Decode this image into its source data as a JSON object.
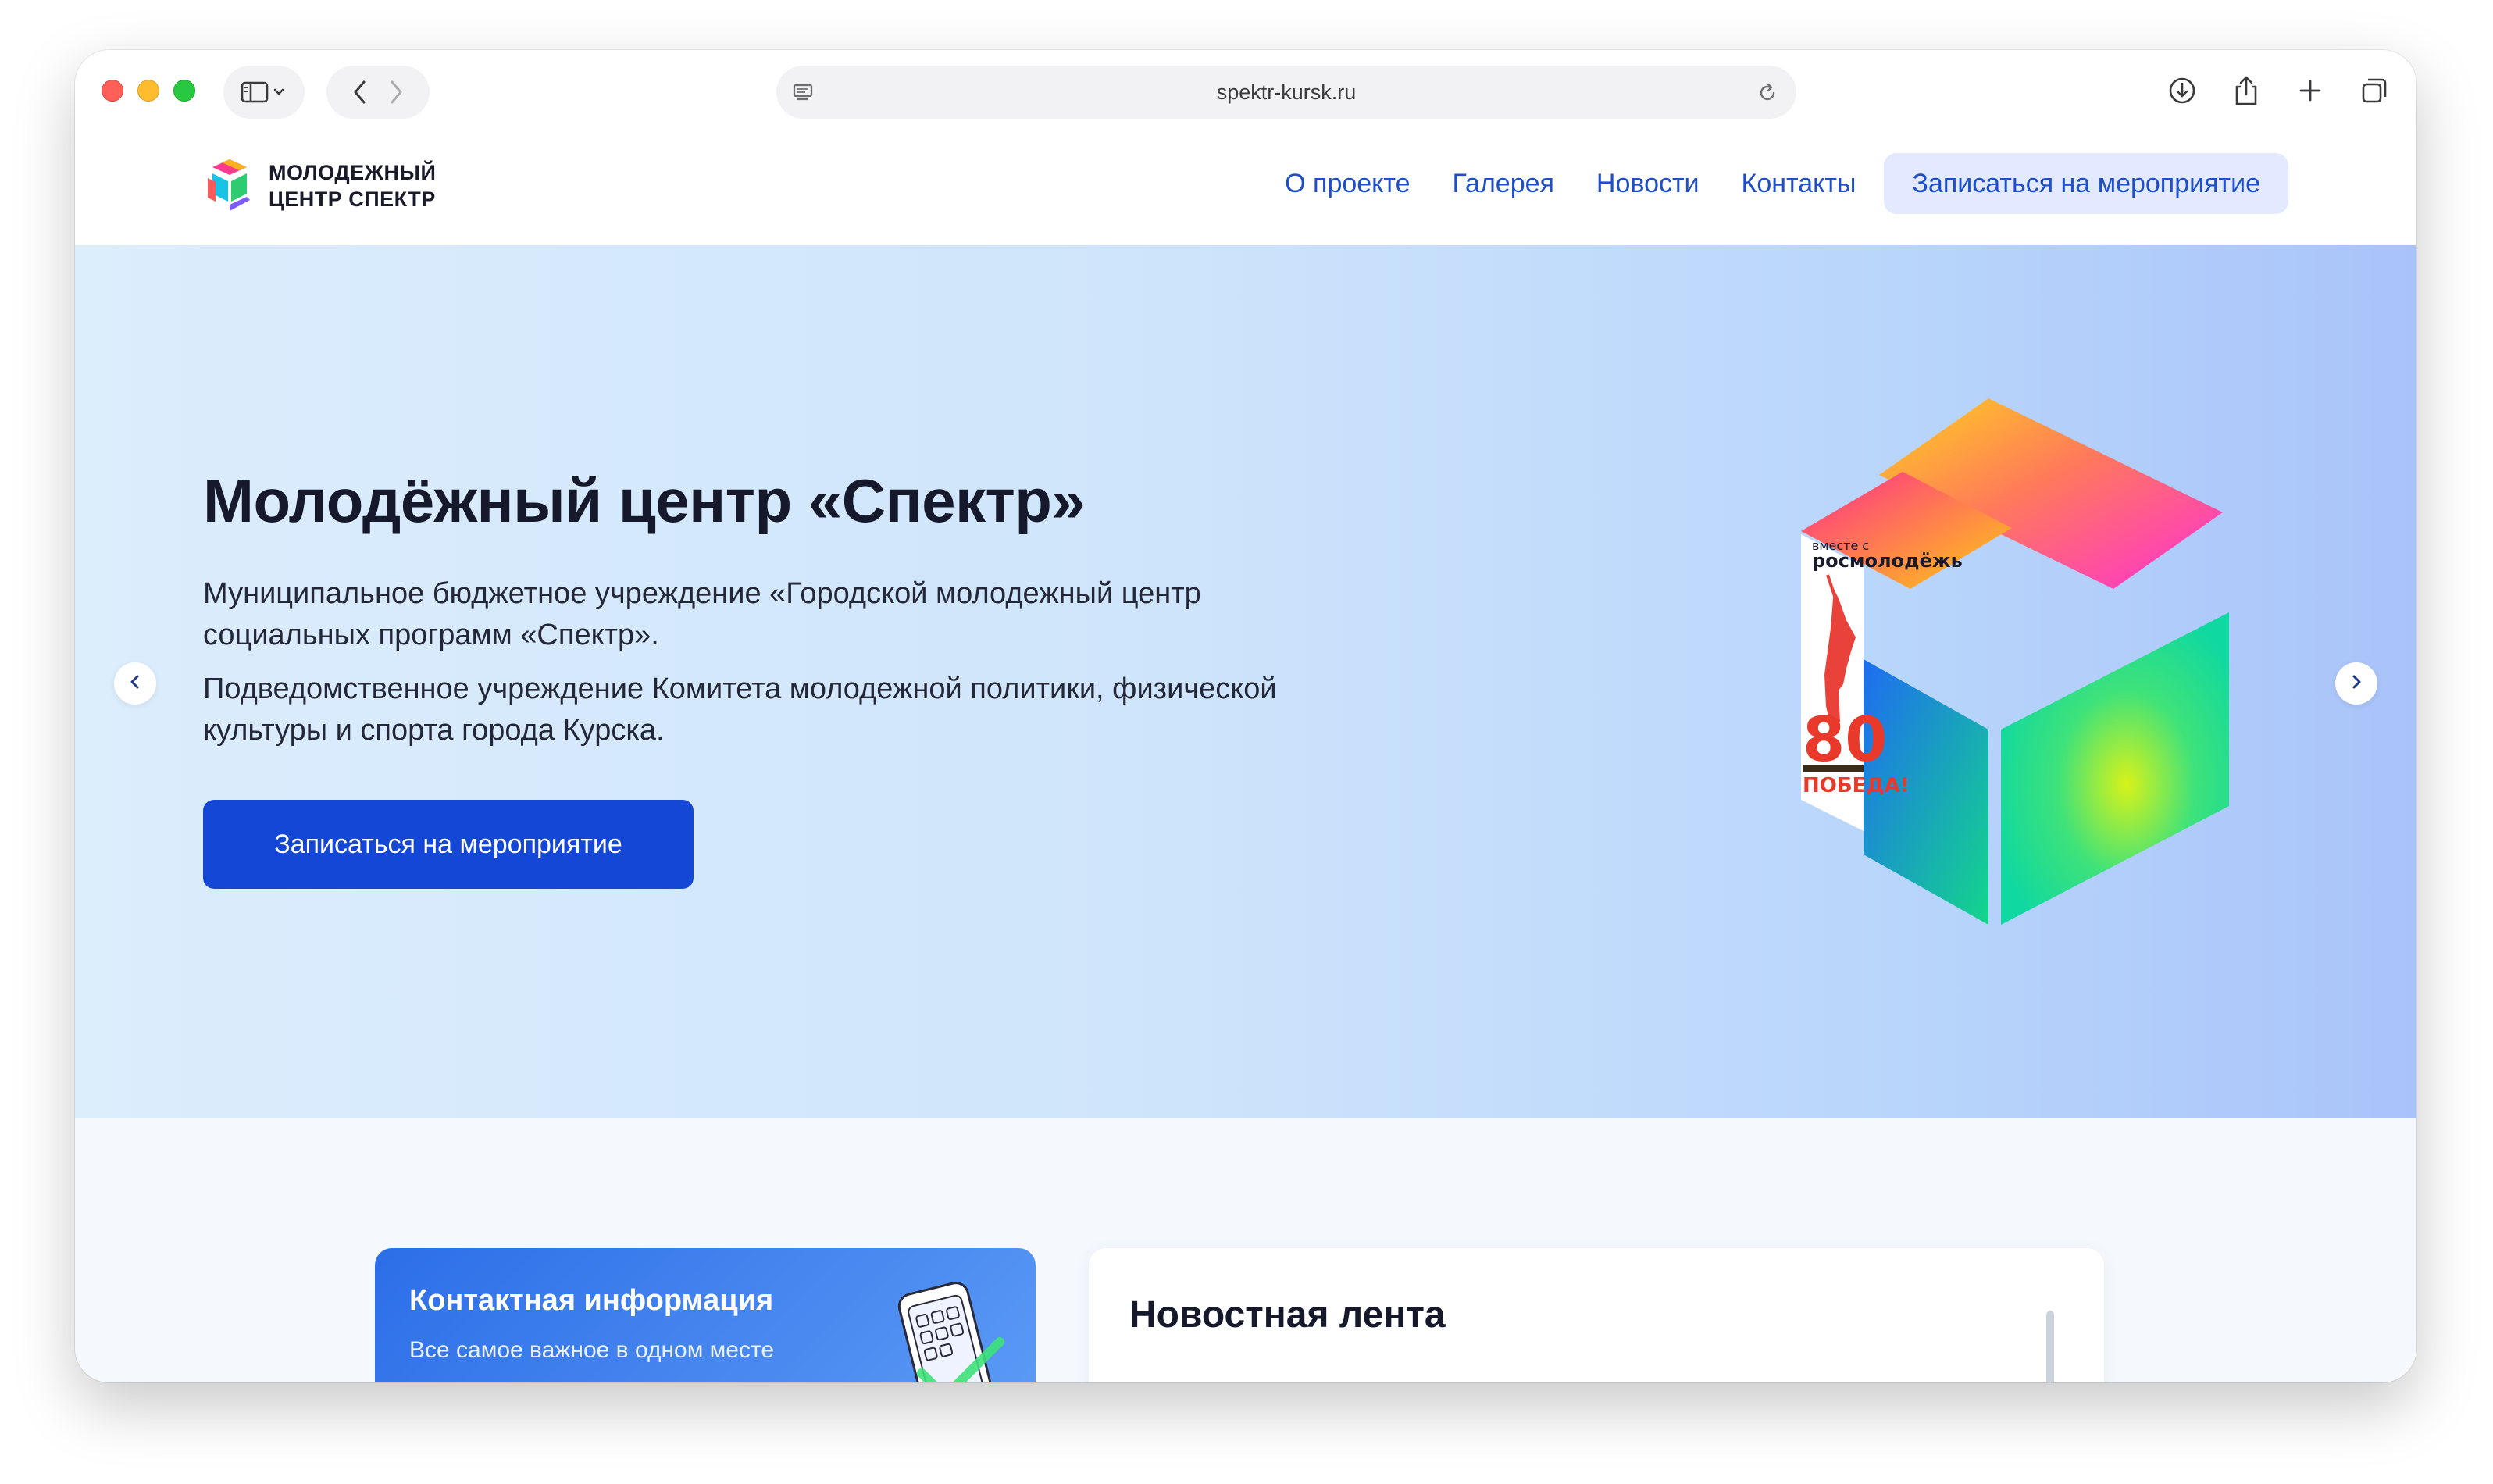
{
  "browser": {
    "url": "spektr-kursk.ru"
  },
  "header": {
    "logo_line1": "МОЛОДЕЖНЫЙ",
    "logo_line2": "ЦЕНТР СПЕКТР",
    "nav": [
      "О проекте",
      "Галерея",
      "Новости",
      "Контакты"
    ],
    "cta": "Записаться на мероприятие"
  },
  "hero": {
    "title": "Молодёжный центр «Спектр»",
    "paragraph1": "Муниципальное бюджетное учреждение «Городской молодежный центр социальных программ «Спектр».",
    "paragraph2": "Подведомственное учреждение Комитета молодежной политики, физической культуры и спорта города Курска.",
    "cta": "Записаться на мероприятие",
    "art": {
      "badge_line1": "вместе с",
      "badge_line2": "росмолодёжь",
      "number": "80",
      "victory": "ПОБЕДА!"
    }
  },
  "sections": {
    "contact_title": "Контактная информация",
    "contact_subtitle": "Все самое важное в одном месте",
    "news_title": "Новостная лента"
  },
  "colors": {
    "accent": "#1447d6",
    "link": "#1e4fc9",
    "nav_cta_bg": "#e3eaff"
  }
}
